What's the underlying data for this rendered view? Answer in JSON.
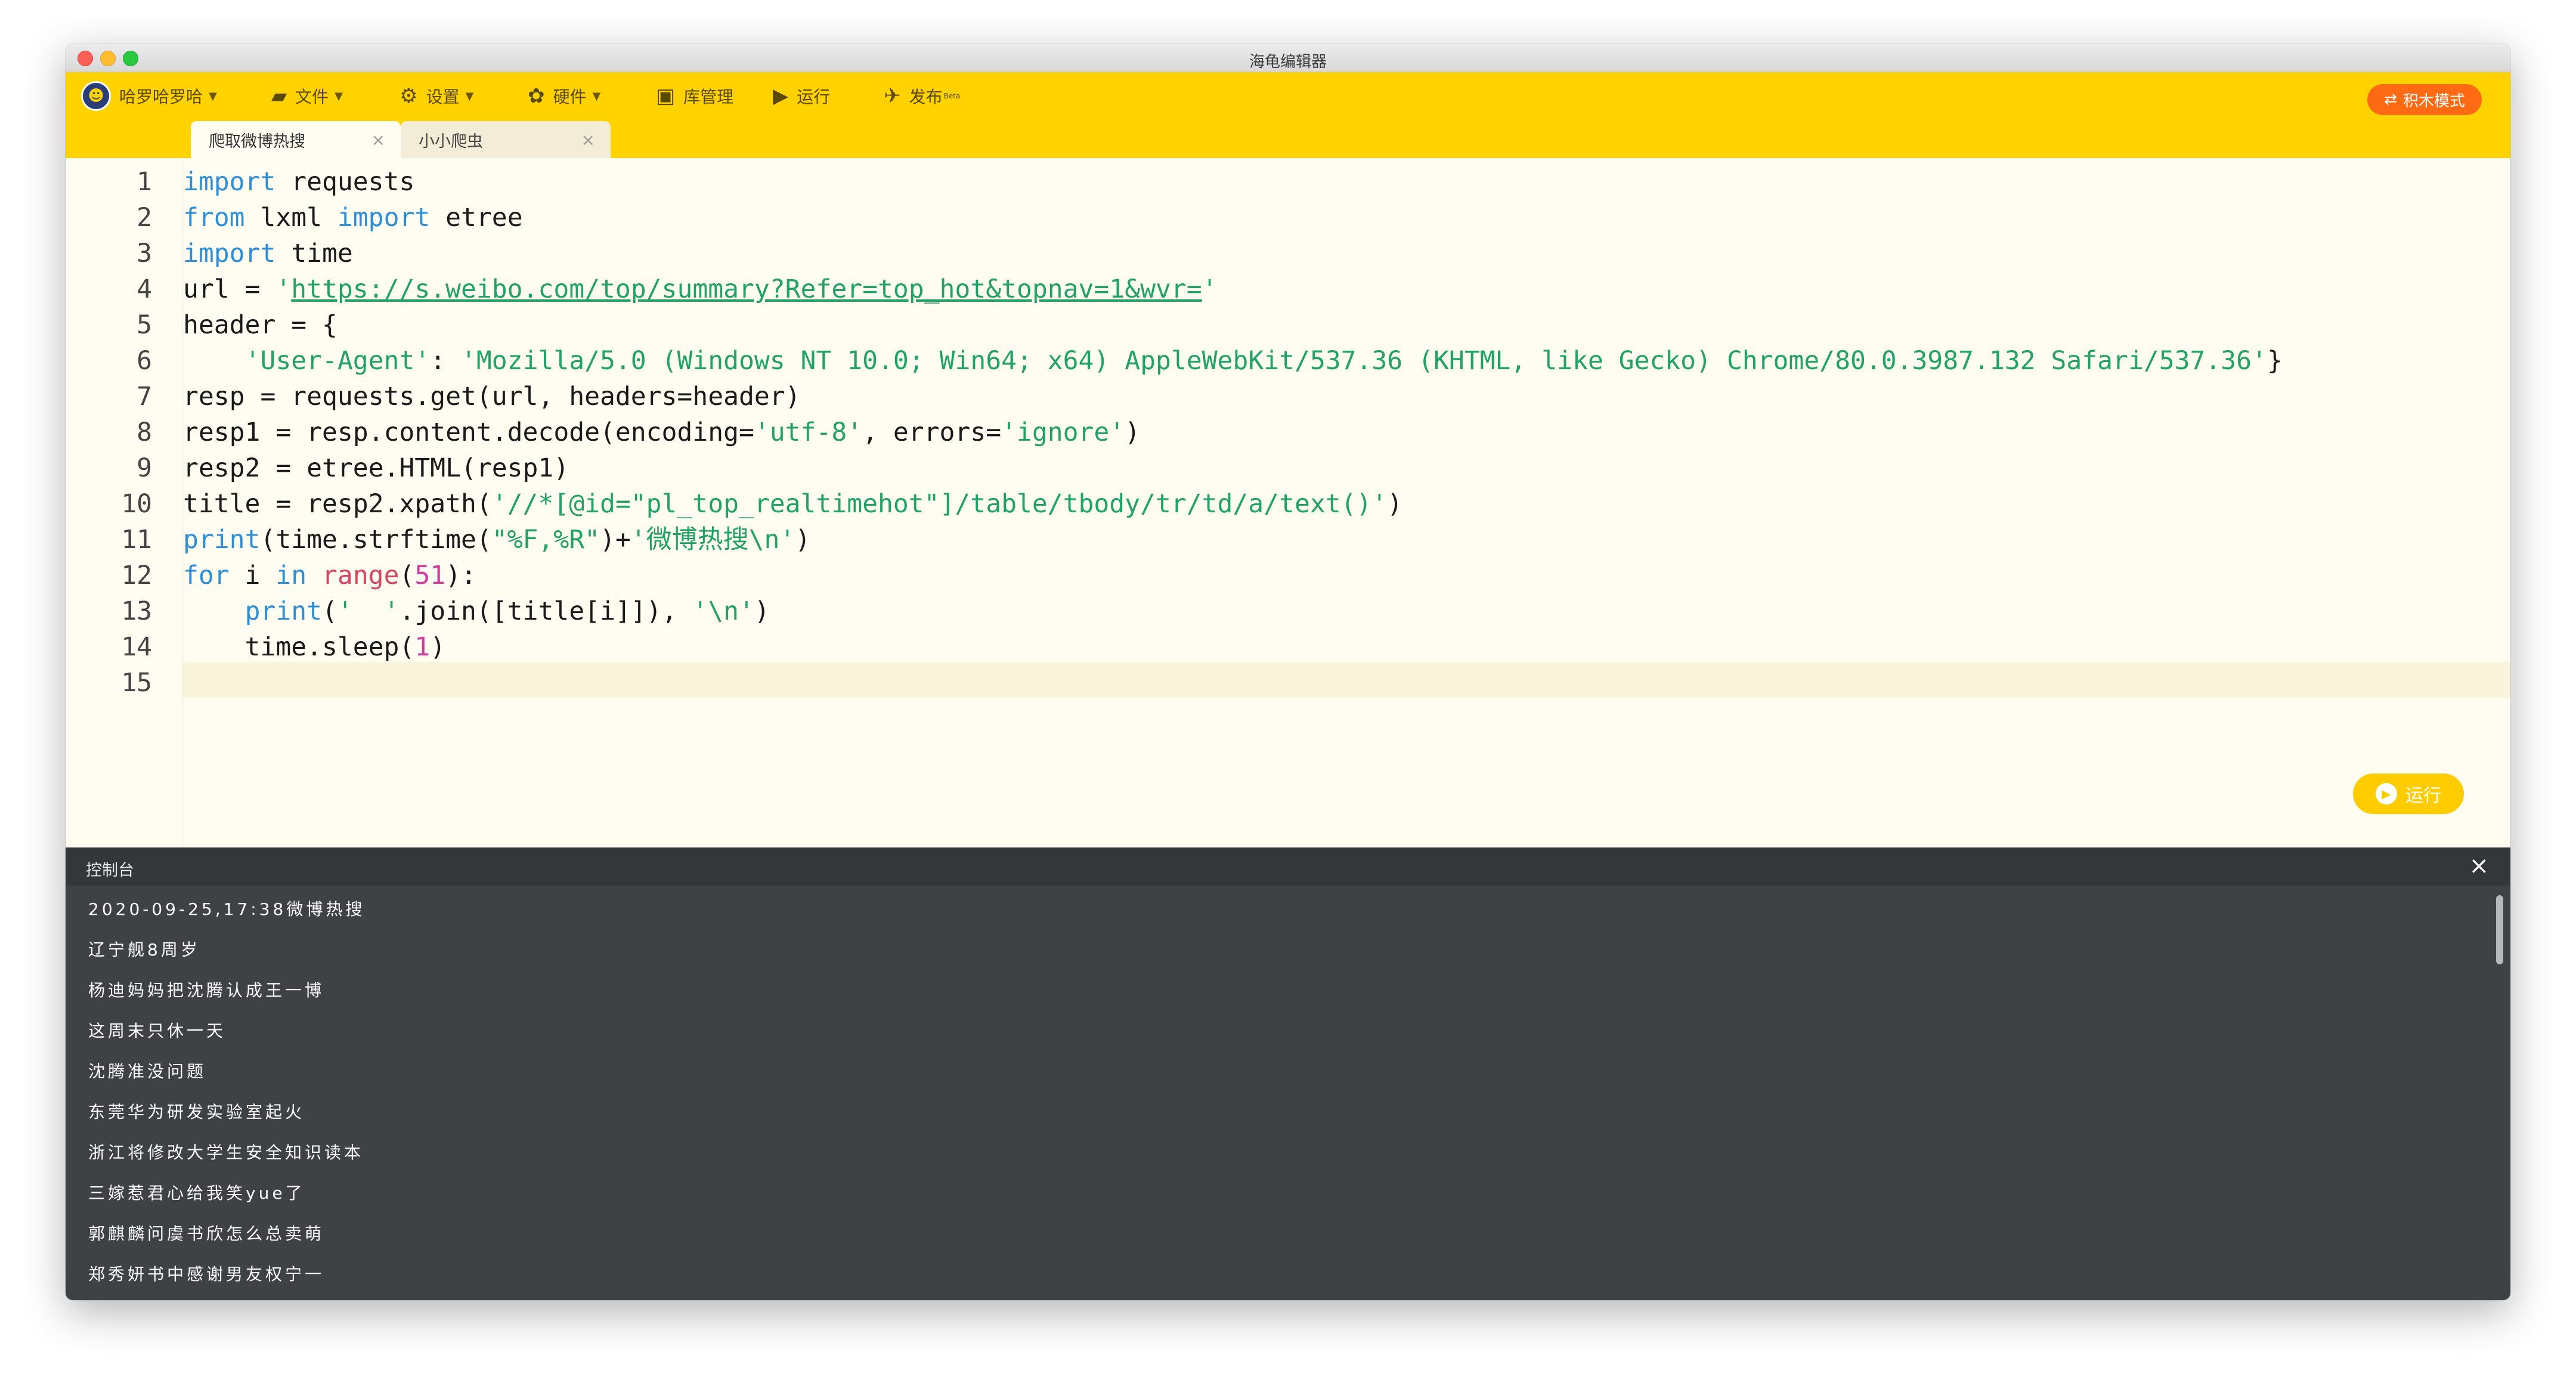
{
  "window": {
    "title": "海龟编辑器"
  },
  "toolbar": {
    "user_name": "哈罗哈罗哈",
    "file_label": "文件",
    "settings_label": "设置",
    "hardware_label": "硬件",
    "library_label": "库管理",
    "run_label": "运行",
    "publish_label": "发布",
    "publish_badge": "Beta",
    "mode_label": "积木模式"
  },
  "tabs": [
    {
      "label": "爬取微博热搜",
      "active": true
    },
    {
      "label": "小小爬虫",
      "active": false
    }
  ],
  "editor": {
    "line_numbers": [
      "1",
      "2",
      "3",
      "4",
      "5",
      "6",
      "7",
      "8",
      "9",
      "10",
      "11",
      "12",
      "13",
      "14",
      "15"
    ],
    "run_button_label": "运行",
    "code": {
      "l1": {
        "kw": "import",
        "rest": " requests"
      },
      "l2": {
        "kw1": "from",
        "mid": " lxml ",
        "kw2": "import",
        "rest": " etree"
      },
      "l3": {
        "kw": "import",
        "rest": " time"
      },
      "l4": {
        "pre": "url = ",
        "q1": "'",
        "url": "https://s.weibo.com/top/summary?Refer=top_hot&topnav=1&wvr=",
        "q2": "'"
      },
      "l5": {
        "text": "header = {"
      },
      "l6": {
        "indent": "    ",
        "key": "'User-Agent'",
        "colon": ": ",
        "value": "'Mozilla/5.0 (Windows NT 10.0; Win64; x64) AppleWebKit/537.36 (KHTML, like Gecko) Chrome/80.0.3987.132 Safari/537.36'",
        "end": "}"
      },
      "l7": {
        "text": "resp = requests.get(url, headers=header)"
      },
      "l8": {
        "pre": "resp1 = resp.content.decode(encoding=",
        "s1": "'utf-8'",
        "mid": ", errors=",
        "s2": "'ignore'",
        "end": ")"
      },
      "l9": {
        "text": "resp2 = etree.HTML(resp1)"
      },
      "l10": {
        "pre": "title = resp2.xpath(",
        "s": "'//*[@id=\"pl_top_realtimehot\"]/table/tbody/tr/td/a/text()'",
        "end": ")"
      },
      "l11": {
        "fn": "print",
        "pre": "(time.strftime(",
        "s1": "\"%F,%R\"",
        "mid": ")+",
        "s2": "'微博热搜\\n'",
        "end": ")"
      },
      "l12": {
        "kw1": "for",
        "mid1": " i ",
        "kw2": "in",
        "sp": " ",
        "blt": "range",
        "open": "(",
        "num": "51",
        "end": "):"
      },
      "l13": {
        "indent": "    ",
        "fn": "print",
        "open": "(",
        "s1": "'  '",
        "mid": ".join([title[i]]), ",
        "s2": "'\\n'",
        "end": ")"
      },
      "l14": {
        "pre": "    time.sleep(",
        "num": "1",
        "end": ")"
      },
      "l15": {
        "text": ""
      }
    }
  },
  "console": {
    "title": "控制台",
    "lines": [
      "2020-09-25,17:38微博热搜",
      "辽宁舰8周岁",
      "杨迪妈妈把沈腾认成王一博",
      "这周末只休一天",
      "沈腾准没问题",
      "东莞华为研发实验室起火",
      "浙江将修改大学生安全知识读本",
      "三嫁惹君心给我笑yue了",
      "郭麒麟问虞书欣怎么总卖萌",
      "郑秀妍书中感谢男友权宁一"
    ]
  }
}
